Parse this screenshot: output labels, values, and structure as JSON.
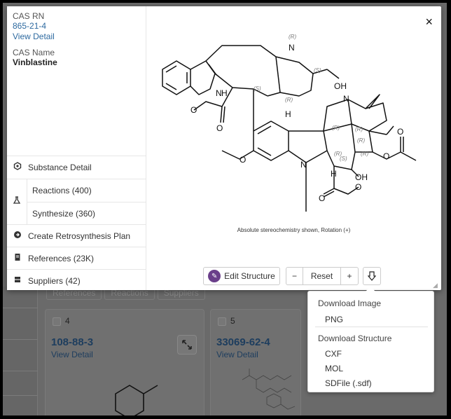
{
  "background": {
    "tabs": [
      "References",
      "Reactions",
      "Suppliers"
    ],
    "cards": [
      {
        "number": "4",
        "cas_rn": "108-88-3",
        "view_detail": "View Detail"
      },
      {
        "number": "5",
        "cas_rn": "33069-62-4",
        "view_detail": "View Detail"
      }
    ]
  },
  "modal": {
    "cas_rn_label": "CAS RN",
    "cas_rn_value": "865-21-4",
    "view_detail": "View Detail",
    "cas_name_label": "CAS Name",
    "cas_name_value": "Vinblastine",
    "nav": {
      "substance_detail": "Substance Detail",
      "reactions": "Reactions (400)",
      "synthesize": "Synthesize (360)",
      "retrosynthesis": "Create Retrosynthesis Plan",
      "references": "References (23K)",
      "suppliers": "Suppliers (42)"
    },
    "close": "×",
    "caption": "Absolute stereochemistry shown, Rotation (+)",
    "structure_labels": {
      "r_top": "(R)",
      "s1": "(S)",
      "s2": "(S)",
      "r2": "(R)",
      "oh1": "OH",
      "n1": "N",
      "nh": "H",
      "n_indole": "N",
      "h1": "H",
      "n2": "N",
      "r3": "(R)",
      "r4": "(R)",
      "r5": "(R)",
      "r6": "(R)",
      "r7": "(R)",
      "s3": "(S)",
      "n3": "N",
      "h2": "H",
      "oh2": "OH",
      "o1": "O",
      "o2": "O",
      "o3": "O",
      "o4": "O",
      "o5": "O",
      "o6": "O",
      "o7": "O"
    },
    "toolbar": {
      "edit_structure": "Edit Structure",
      "zoom_out": "−",
      "reset": "Reset",
      "zoom_in": "+"
    }
  },
  "download_menu": {
    "image_header": "Download Image",
    "png": "PNG",
    "structure_header": "Download Structure",
    "cxf": "CXF",
    "mol": "MOL",
    "sdf": "SDFile (.sdf)"
  },
  "colors": {
    "link": "#2e6aa0",
    "edit_icon": "#6a3f8a"
  }
}
